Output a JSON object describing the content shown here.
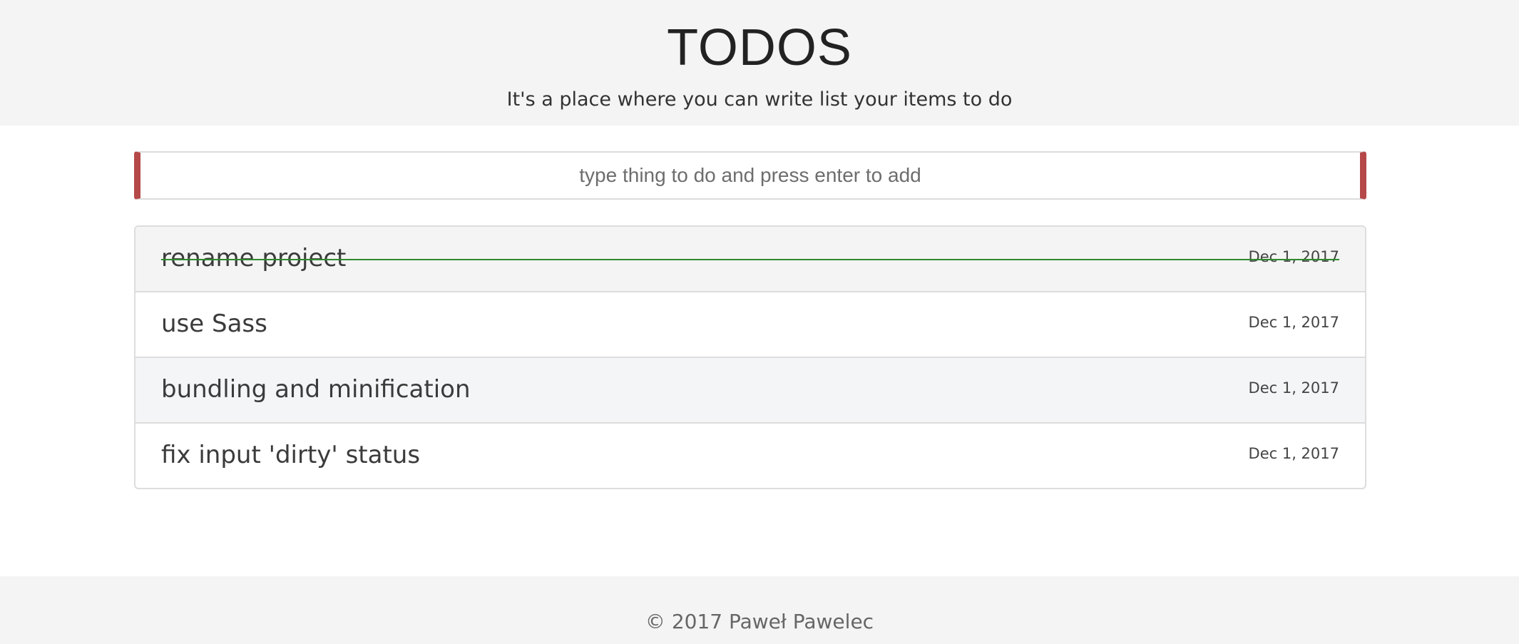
{
  "header": {
    "title": "TODOS",
    "subtitle": "It's a place where you can write list your items to do"
  },
  "new_todo": {
    "placeholder": "type thing to do and press enter to add",
    "value": ""
  },
  "todos": [
    {
      "title": "rename project",
      "date": "Dec 1, 2017",
      "done": true
    },
    {
      "title": "use Sass",
      "date": "Dec 1, 2017",
      "done": false
    },
    {
      "title": "bundling and minification",
      "date": "Dec 1, 2017",
      "done": false
    },
    {
      "title": "fix input 'dirty' status",
      "date": "Dec 1, 2017",
      "done": false
    }
  ],
  "footer": {
    "copyright": "© 2017 Paweł Pawelec"
  },
  "colors": {
    "input_accent": "#b54848",
    "done_strike": "#2f8a2f",
    "header_bg": "#f4f4f4"
  }
}
